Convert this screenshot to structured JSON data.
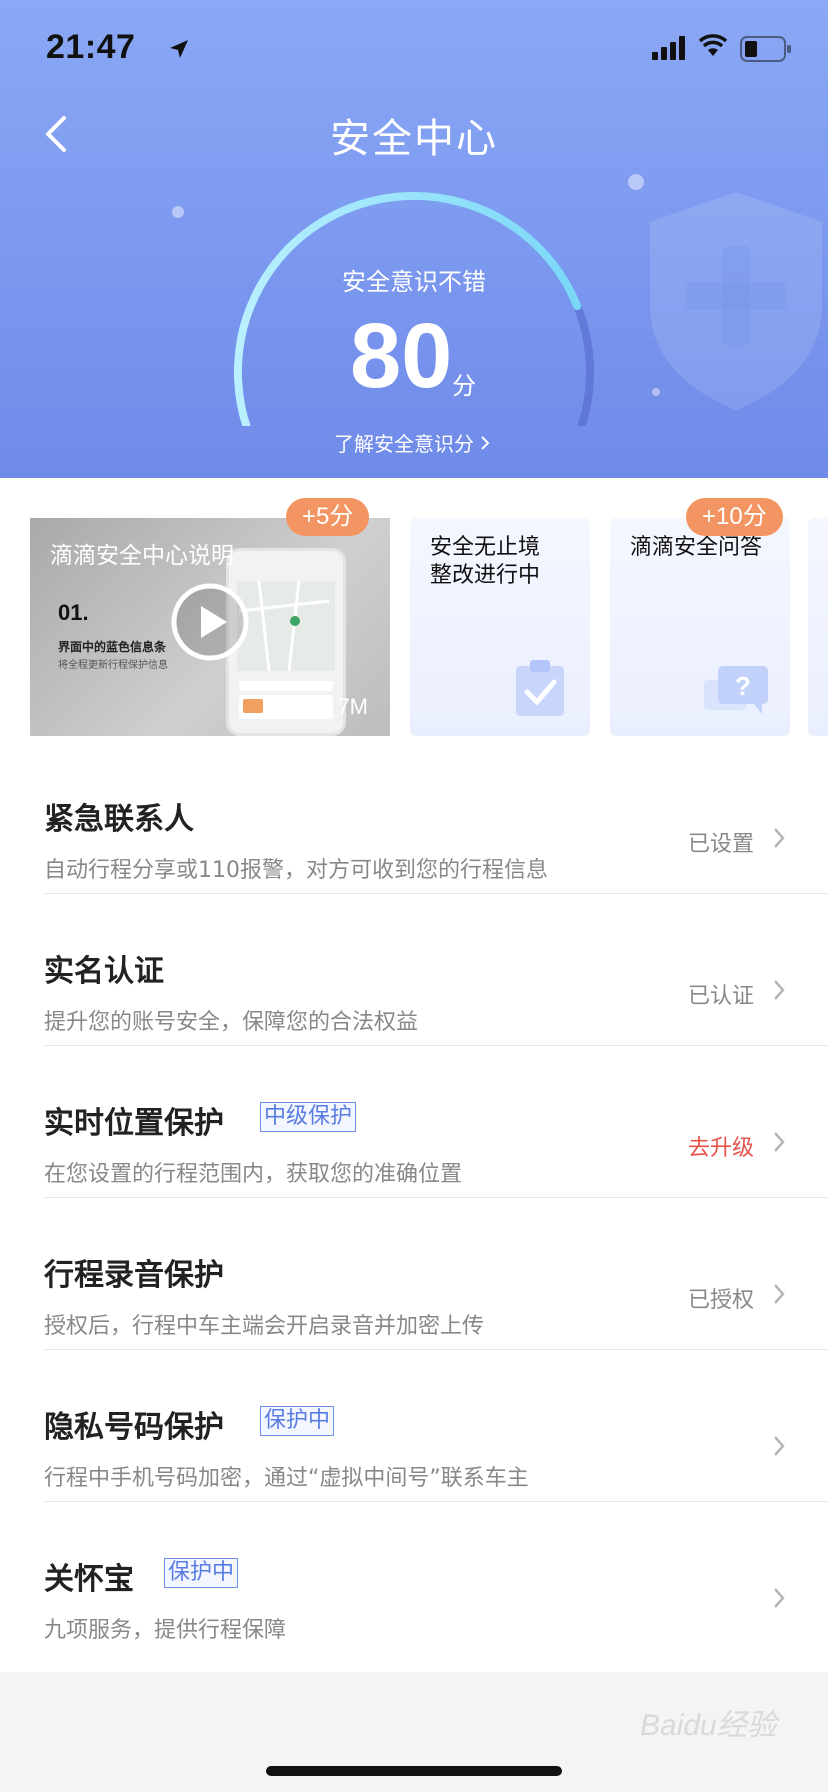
{
  "status_bar": {
    "time": "21:47"
  },
  "header": {
    "title": "安全中心",
    "score_caption": "安全意识不错",
    "score": "80",
    "score_unit": "分",
    "learn_link": "了解安全意识分",
    "score_progress_fraction": 0.8
  },
  "cards": [
    {
      "title": "滴滴安全中心说明",
      "badge": "+5分",
      "step": "01.",
      "sub1": "界面中的蓝色信息条",
      "sub2": "将全程更新行程保护信息",
      "duration": "7M",
      "icon": "play-icon"
    },
    {
      "title_line1": "安全无止境",
      "title_line2": "整改进行中",
      "icon": "clipboard-check-icon"
    },
    {
      "title": "滴滴安全问答",
      "badge": "+10分",
      "icon": "question-chat-icon"
    }
  ],
  "list": [
    {
      "title": "紧急联系人",
      "desc": "自动行程分享或110报警，对方可收到您的行程信息",
      "status": "已设置"
    },
    {
      "title": "实名认证",
      "desc": "提升您的账号安全，保障您的合法权益",
      "status": "已认证"
    },
    {
      "title": "实时位置保护",
      "tag": "中级保护",
      "desc": "在您设置的行程范围内，获取您的准确位置",
      "status": "去升级",
      "status_color": "#e5534b"
    },
    {
      "title": "行程录音保护",
      "desc": "授权后，行程中车主端会开启录音并加密上传",
      "status": "已授权"
    },
    {
      "title": "隐私号码保护",
      "tag": "保护中",
      "desc": "行程中手机号码加密，通过“虚拟中间号”联系车主",
      "status": ""
    },
    {
      "title": "关怀宝",
      "tag": "保护中",
      "desc": "九项服务，提供行程保障",
      "status": ""
    }
  ],
  "colors": {
    "header_blue": "#7b98ef",
    "badge_orange": "#f39563",
    "tag_blue": "#5a7de3",
    "warn_red": "#e5534b"
  }
}
